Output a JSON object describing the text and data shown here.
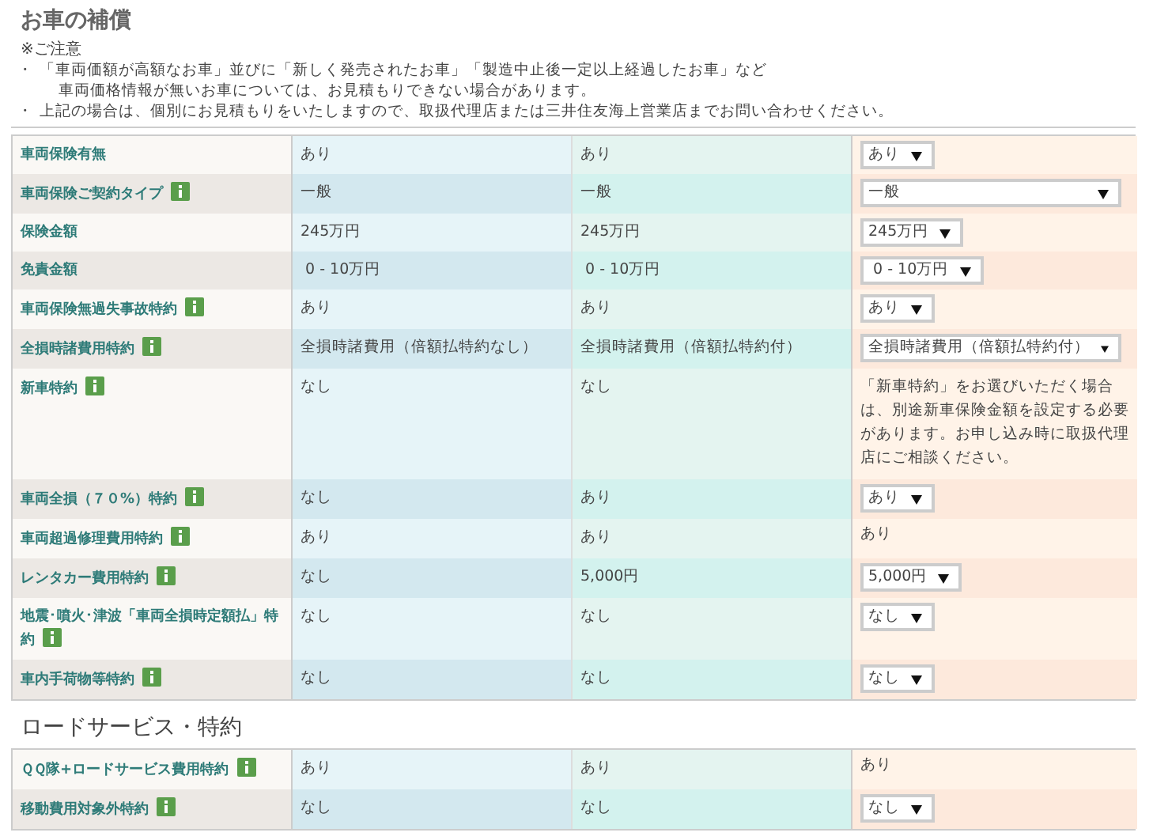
{
  "title": "お車の補償",
  "notice": {
    "heading": "※ご注意",
    "items": [
      {
        "bullet": "・",
        "lines": [
          "「車両価額が高額なお車」並びに「新しく発売されたお車」「製造中止後一定以上経過したお車」など",
          "車両価格情報が無いお車については、お見積もりできない場合があります。"
        ]
      },
      {
        "bullet": "・",
        "lines": [
          "上記の場合は、個別にお見積もりをいたしますので、取扱代理店または三井住友海上営業店までお問い合わせください。"
        ]
      }
    ]
  },
  "sections": [
    {
      "rows": [
        {
          "label": "車両保険有無",
          "info": false,
          "values": [
            "あり",
            "あり"
          ],
          "control": {
            "kind": "select",
            "value": "あり"
          }
        },
        {
          "label": "車両保険ご契約タイプ",
          "info": true,
          "values": [
            "一般",
            "一般"
          ],
          "control": {
            "kind": "select-wide",
            "value": "一般"
          }
        },
        {
          "label": "保険金額",
          "info": false,
          "values": [
            "245万円",
            "245万円"
          ],
          "control": {
            "kind": "select",
            "value": "245万円"
          }
        },
        {
          "label": "免責金額",
          "info": false,
          "values": [
            " 0 - 10万円",
            " 0 - 10万円"
          ],
          "control": {
            "kind": "select",
            "value": " 0 - 10万円"
          }
        },
        {
          "label": "車両保険無過失事故特約",
          "info": true,
          "values": [
            "あり",
            "あり"
          ],
          "control": {
            "kind": "select",
            "value": "あり"
          }
        },
        {
          "label": "全損時諸費用特約",
          "info": true,
          "values": [
            "全損時諸費用（倍額払特約なし）",
            "全損時諸費用（倍額払特約付）"
          ],
          "control": {
            "kind": "select-wide",
            "value": "全損時諸費用（倍額払特約付）"
          }
        },
        {
          "label": "新車特約",
          "info": true,
          "values": [
            "なし",
            "なし"
          ],
          "control": {
            "kind": "note",
            "value": "「新車特約」をお選びいただく場合は、別途新車保険金額を設定する必要があります。お申し込み時に取扱代理店にご相談ください。"
          }
        },
        {
          "label": "車両全損（７０%）特約",
          "info": true,
          "values": [
            "なし",
            "あり"
          ],
          "control": {
            "kind": "select",
            "value": "あり"
          }
        },
        {
          "label": "車両超過修理費用特約",
          "info": true,
          "values": [
            "あり",
            "あり"
          ],
          "control": {
            "kind": "text",
            "value": "あり"
          }
        },
        {
          "label": "レンタカー費用特約",
          "info": true,
          "values": [
            "なし",
            "5,000円"
          ],
          "control": {
            "kind": "select",
            "value": "5,000円"
          }
        },
        {
          "label": "地震･噴火･津波「車両全損時定額払」特約",
          "info": true,
          "values": [
            "なし",
            "なし"
          ],
          "control": {
            "kind": "select",
            "value": "なし"
          }
        },
        {
          "label": "車内手荷物等特約",
          "info": true,
          "values": [
            "なし",
            "なし"
          ],
          "control": {
            "kind": "select",
            "value": "なし"
          }
        }
      ]
    },
    {
      "title": "ロードサービス・特約",
      "rows": [
        {
          "label": "ＱＱ隊+ロードサービス費用特約",
          "info": true,
          "values": [
            "あり",
            "あり"
          ],
          "control": {
            "kind": "text",
            "value": "あり"
          }
        },
        {
          "label": "移動費用対象外特約",
          "info": true,
          "values": [
            "なし",
            "なし"
          ],
          "control": {
            "kind": "select",
            "value": "なし"
          }
        }
      ]
    }
  ]
}
